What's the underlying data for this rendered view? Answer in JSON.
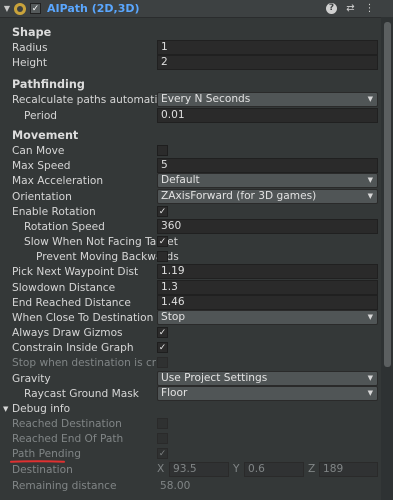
{
  "header": {
    "title": "AIPath (2D,3D)",
    "enabled": "✓",
    "fold": "▼",
    "help_icon": "?",
    "settings_icon": "⇄",
    "menu_icon": "⋮"
  },
  "shape": {
    "heading": "Shape",
    "radius_label": "Radius",
    "radius_value": "1",
    "height_label": "Height",
    "height_value": "2"
  },
  "pathfinding": {
    "heading": "Pathfinding",
    "recalc_label": "Recalculate paths automatically",
    "recalc_value": "Every N Seconds",
    "period_label": "Period",
    "period_value": "0.01"
  },
  "movement": {
    "heading": "Movement",
    "can_move_label": "Can Move",
    "max_speed_label": "Max Speed",
    "max_speed_value": "5",
    "max_accel_label": "Max Acceleration",
    "max_accel_value": "Default",
    "orientation_label": "Orientation",
    "orientation_value": "ZAxisForward (for 3D games)",
    "enable_rotation_label": "Enable Rotation",
    "enable_rotation_check": "✓",
    "rotation_speed_label": "Rotation Speed",
    "rotation_speed_value": "360",
    "slow_label": "Slow When Not Facing Target",
    "slow_check": "✓",
    "prevent_label": "Prevent Moving Backwards",
    "pick_next_label": "Pick Next Waypoint Dist",
    "pick_next_value": "1.19",
    "slowdown_label": "Slowdown Distance",
    "slowdown_value": "1.3",
    "end_reached_label": "End Reached Distance",
    "end_reached_value": "1.46",
    "when_close_label": "When Close To Destination",
    "when_close_value": "Stop",
    "gizmos_label": "Always Draw Gizmos",
    "gizmos_check": "✓",
    "constrain_label": "Constrain Inside Graph",
    "constrain_check": "✓",
    "stop_crowded_label": "Stop when destination is crowded",
    "gravity_label": "Gravity",
    "gravity_value": "Use Project Settings",
    "raycast_label": "Raycast Ground Mask",
    "raycast_value": "Floor"
  },
  "debug": {
    "heading": "Debug info",
    "fold": "▼",
    "reached_dest_label": "Reached Destination",
    "reached_end_label": "Reached End Of Path",
    "path_pending_label": "Path Pending",
    "path_pending_check": "✓",
    "destination_label": "Destination",
    "x_label": "X",
    "x_value": "93.5",
    "y_label": "Y",
    "y_value": "0.6",
    "z_label": "Z",
    "z_value": "189",
    "remaining_label": "Remaining distance",
    "remaining_value": "58.00"
  },
  "colors": {
    "title_blue": "#5aa7ff",
    "annotation_red": "#e03030"
  }
}
